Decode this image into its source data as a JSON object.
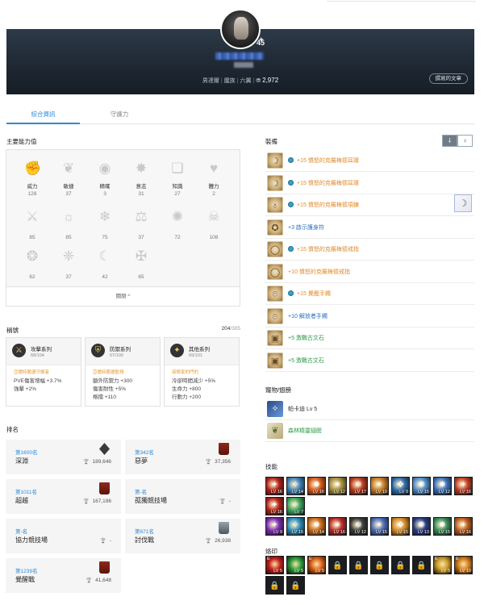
{
  "header": {
    "level": "45",
    "meta_parts": [
      "男達爾",
      "魔族",
      "六翼"
    ],
    "points": "2,972",
    "posts_button": "撰寫的文章"
  },
  "tabs": [
    {
      "label": "綜合資訊",
      "active": true
    },
    {
      "label": "守護力",
      "active": false
    }
  ],
  "stats": {
    "title": "主要能力值",
    "close_label": "關閉 ^",
    "items": [
      {
        "label": "威力",
        "value": "128",
        "icon": "fist-icon"
      },
      {
        "label": "敏捷",
        "value": "37",
        "icon": "wing-feather-icon"
      },
      {
        "label": "精確",
        "value": "3",
        "icon": "eye-icon"
      },
      {
        "label": "意志",
        "value": "31",
        "icon": "star-burst-icon"
      },
      {
        "label": "知識",
        "value": "27",
        "icon": "book-icon"
      },
      {
        "label": "體力",
        "value": "2",
        "icon": "heart-icon"
      },
      {
        "label": "",
        "value": "85",
        "icon": "sword-wings-icon"
      },
      {
        "label": "",
        "value": "85",
        "icon": "sun-face-icon"
      },
      {
        "label": "",
        "value": "75",
        "icon": "snowflake-icon"
      },
      {
        "label": "",
        "value": "37",
        "icon": "scales-icon"
      },
      {
        "label": "",
        "value": "72",
        "icon": "spiral-star-icon"
      },
      {
        "label": "",
        "value": "108",
        "icon": "skull-icon"
      },
      {
        "label": "",
        "value": "62",
        "icon": "tree-emblem-icon"
      },
      {
        "label": "",
        "value": "37",
        "icon": "butterfly-icon"
      },
      {
        "label": "",
        "value": "42",
        "icon": "crescent-icon"
      },
      {
        "label": "",
        "value": "65",
        "icon": "cross-swords-icon"
      }
    ]
  },
  "titles": {
    "title": "稱號",
    "count": "204",
    "max": "/305",
    "cards": [
      {
        "name": "攻擊系列",
        "count": "68/104",
        "sub": "亞爾特蘭德守護者",
        "lines": [
          "PVE傷害增幅 +3.7%",
          "強擊 +2%"
        ]
      },
      {
        "name": "防禦系列",
        "count": "67/100",
        "sub": "亞爾特蘭德監視",
        "lines": [
          "額外防禦力 +300",
          "傷害耐性 +5%",
          "格擋 +110"
        ]
      },
      {
        "name": "其他系列",
        "count": "69/101",
        "sub": "探險家的門的",
        "lines": [
          "冷卻時間減少 +5%",
          "生命力 +800",
          "行動力 +200"
        ]
      }
    ]
  },
  "ranking": {
    "title": "排名",
    "cards": [
      {
        "rank": "第1600名",
        "name": "深淵",
        "value": "189,646",
        "emblem": "emb-dark"
      },
      {
        "rank": "第342名",
        "name": "惡夢",
        "value": "37,356",
        "emblem": "emb-red"
      },
      {
        "rank": "第1011名",
        "name": "超越",
        "value": "167,196",
        "emblem": "emb-red"
      },
      {
        "rank": "第-名",
        "name": "孤獨競技場",
        "value": "-",
        "emblem": ""
      },
      {
        "rank": "第-名",
        "name": "協力競技場",
        "value": "-",
        "emblem": ""
      },
      {
        "rank": "第871名",
        "name": "討伐戰",
        "value": "26,938",
        "emblem": "emb-silver"
      },
      {
        "rank": "第1239名",
        "name": "覺醒戰",
        "value": "41,648",
        "emblem": "emb-red"
      }
    ]
  },
  "equipment": {
    "title": "裝備",
    "toggle_a": "⸸",
    "toggle_b": "♀",
    "items": [
      {
        "text": "+15 憤怒的克羅梅德耳環",
        "color": "orn",
        "gem": true,
        "icon": "earring-icon"
      },
      {
        "text": "+15 憤怒的克羅梅德耳環",
        "color": "orn",
        "gem": true,
        "icon": "earring-icon"
      },
      {
        "text": "+15 憤怒的克羅梅德項鍊",
        "color": "orn",
        "gem": true,
        "icon": "necklace-icon"
      },
      {
        "text": "+3 啟示護身符",
        "color": "blu",
        "gem": false,
        "icon": "amulet-icon"
      },
      {
        "text": "+15 憤怒的克羅梅德戒指",
        "color": "orn",
        "gem": true,
        "icon": "ring-icon"
      },
      {
        "text": "+10 憤怒的克羅梅德戒指",
        "color": "orn",
        "gem": false,
        "icon": "ring-icon"
      },
      {
        "text": "+15 覺醒手鐲",
        "color": "orn",
        "gem": true,
        "icon": "bracelet-icon"
      },
      {
        "text": "+10 解放者手鐲",
        "color": "blu",
        "gem": false,
        "icon": "bracelet-icon"
      },
      {
        "text": "+5 激戰古文石",
        "color": "grn",
        "gem": false,
        "icon": "runestone-icon"
      },
      {
        "text": "+5 激戰古文石",
        "color": "grn",
        "gem": false,
        "icon": "runestone-icon"
      }
    ]
  },
  "pets": {
    "title": "寵物/翅膀",
    "items": [
      {
        "text": "帕卡迪 Lv 5",
        "color": "#333",
        "icon": "pet-icon"
      },
      {
        "text": "森林精靈翅膀",
        "color": "#2f9a4a",
        "icon": "wings-icon"
      }
    ]
  },
  "skills": {
    "title": "技能",
    "row1": [
      "LV 16",
      "LV 14",
      "LV 16",
      "LV 12",
      "LV 17",
      "LV 19",
      "LV 9",
      "LV 15",
      "LV 12",
      "LV 16"
    ],
    "row2": [
      "LV 16",
      "LV 7"
    ],
    "row3": [
      "LV 9",
      "LV 15",
      "LV 14",
      "LV 16",
      "LV 12",
      "LV 15",
      "LV 15",
      "LV 13",
      "LV 15",
      "LV 16"
    ],
    "colors1": [
      "#b0221a",
      "#3e7fb6",
      "#d2581a",
      "#a08a3a",
      "#b83a1e",
      "#c47a22",
      "#2e6aa8",
      "#4a8ac8",
      "#3a70b8",
      "#c03a22"
    ],
    "colors2": [
      "#b0221a",
      "#3aa05a"
    ],
    "colors3": [
      "#7a2ab0",
      "#2a8ab8",
      "#c86a1a",
      "#b82a2a",
      "#3a3a3a",
      "#4a6ab8",
      "#d28a2a",
      "#2a3a88",
      "#3a8a5a",
      "#b85a1a"
    ]
  },
  "runes": {
    "title": "烙印",
    "row1": [
      {
        "lv": "LV 5",
        "e": "E",
        "color": "#c0201a",
        "locked": false
      },
      {
        "lv": "LV 5",
        "e": "",
        "color": "#2a9a3a",
        "locked": false
      },
      {
        "lv": "LV 5",
        "e": "E",
        "color": "#d8601a",
        "locked": false
      },
      {
        "lv": "",
        "e": "",
        "color": "#1b1d22",
        "locked": true
      },
      {
        "lv": "",
        "e": "",
        "color": "#1b1d22",
        "locked": true
      },
      {
        "lv": "",
        "e": "",
        "color": "#1b1d22",
        "locked": true
      },
      {
        "lv": "",
        "e": "",
        "color": "#1b1d22",
        "locked": true
      },
      {
        "lv": "",
        "e": "",
        "color": "#1b1d22",
        "locked": true
      },
      {
        "lv": "LV 5",
        "e": "E",
        "color": "#c89a2a",
        "locked": false
      },
      {
        "lv": "LV 10",
        "e": "E",
        "color": "#d07a1a",
        "locked": false
      }
    ],
    "row2": [
      {
        "lv": "",
        "e": "",
        "color": "#1b1d22",
        "locked": true
      },
      {
        "lv": "",
        "e": "",
        "color": "#1b1d22",
        "locked": true
      }
    ]
  }
}
